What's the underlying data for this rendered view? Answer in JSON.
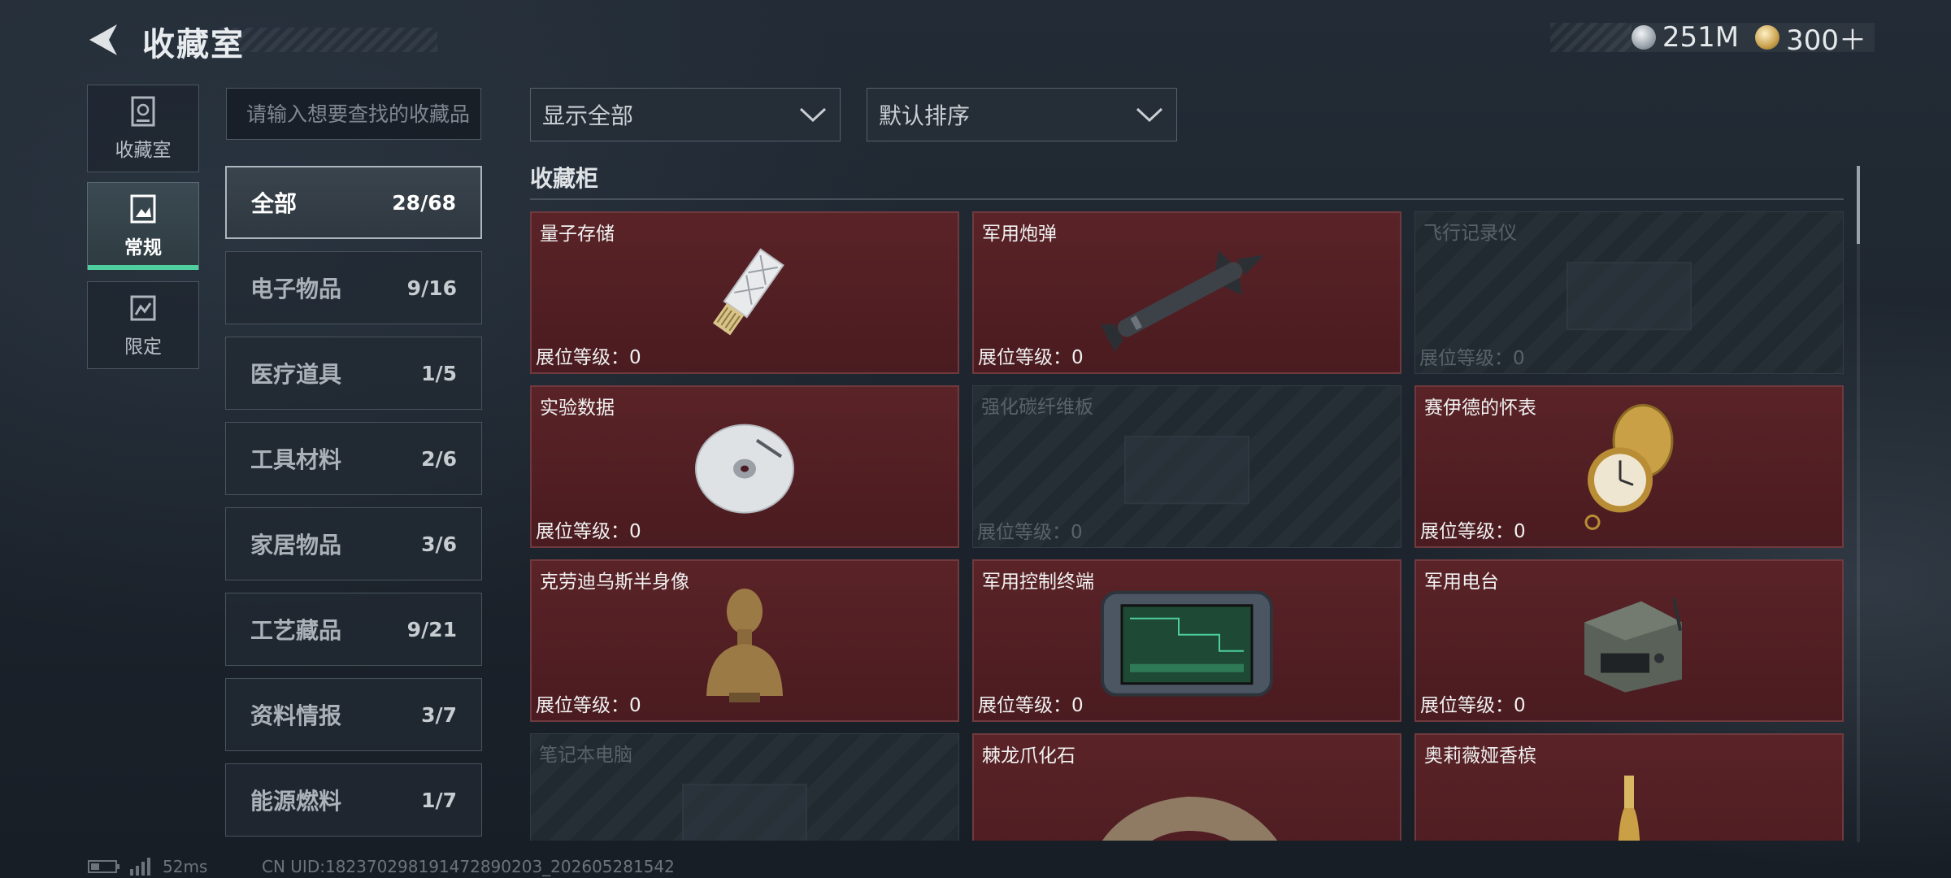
{
  "header": {
    "title": "收藏室"
  },
  "currency": [
    {
      "icon": "silver-coin-icon",
      "value": "251M"
    },
    {
      "icon": "gold-coin-icon",
      "value": "300＋"
    }
  ],
  "mode_tabs": [
    {
      "label": "收藏室",
      "icon": "trophy-case-icon",
      "active": false
    },
    {
      "label": "常规",
      "icon": "picture-frame-icon",
      "active": true
    },
    {
      "label": "限定",
      "icon": "limited-frame-icon",
      "active": false
    }
  ],
  "search": {
    "placeholder": "请输入想要查找的收藏品"
  },
  "categories": [
    {
      "name": "全部",
      "count": "28/68",
      "active": true
    },
    {
      "name": "电子物品",
      "count": "9/16"
    },
    {
      "name": "医疗道具",
      "count": "1/5"
    },
    {
      "name": "工具材料",
      "count": "2/6"
    },
    {
      "name": "家居物品",
      "count": "3/6"
    },
    {
      "name": "工艺藏品",
      "count": "9/21"
    },
    {
      "name": "资料情报",
      "count": "3/7"
    },
    {
      "name": "能源燃料",
      "count": "1/7"
    }
  ],
  "filters": {
    "display": "显示全部",
    "sort": "默认排序"
  },
  "cabinet": {
    "title": "收藏柜",
    "items": [
      {
        "name": "量子存储",
        "level": "展位等级：0",
        "owned": true,
        "icon": "usb-drive-icon"
      },
      {
        "name": "军用炮弹",
        "level": "展位等级：0",
        "owned": true,
        "icon": "missile-icon"
      },
      {
        "name": "飞行记录仪",
        "level": "展位等级：0",
        "owned": false,
        "icon": "flight-recorder-icon"
      },
      {
        "name": "实验数据",
        "level": "展位等级：0",
        "owned": true,
        "icon": "disc-icon"
      },
      {
        "name": "强化碳纤维板",
        "level": "展位等级：0",
        "owned": false,
        "icon": "carbon-plate-icon"
      },
      {
        "name": "赛伊德的怀表",
        "level": "展位等级：0",
        "owned": true,
        "icon": "pocket-watch-icon"
      },
      {
        "name": "克劳迪乌斯半身像",
        "level": "展位等级：0",
        "owned": true,
        "icon": "bust-icon"
      },
      {
        "name": "军用控制终端",
        "level": "展位等级：0",
        "owned": true,
        "icon": "control-terminal-icon"
      },
      {
        "name": "军用电台",
        "level": "展位等级：0",
        "owned": true,
        "icon": "radio-icon"
      },
      {
        "name": "笔记本电脑",
        "level": "",
        "owned": false,
        "icon": "laptop-icon"
      },
      {
        "name": "棘龙爪化石",
        "level": "",
        "owned": true,
        "icon": "claw-fossil-icon"
      },
      {
        "name": "奥莉薇娅香槟",
        "level": "",
        "owned": true,
        "icon": "champagne-icon"
      }
    ]
  },
  "status": {
    "ping": "52ms",
    "uid": "CN UID:1823702981914728902​03_202605281542"
  },
  "colors": {
    "accent": "#4fcf9e",
    "owned_card": "#5a2327"
  }
}
